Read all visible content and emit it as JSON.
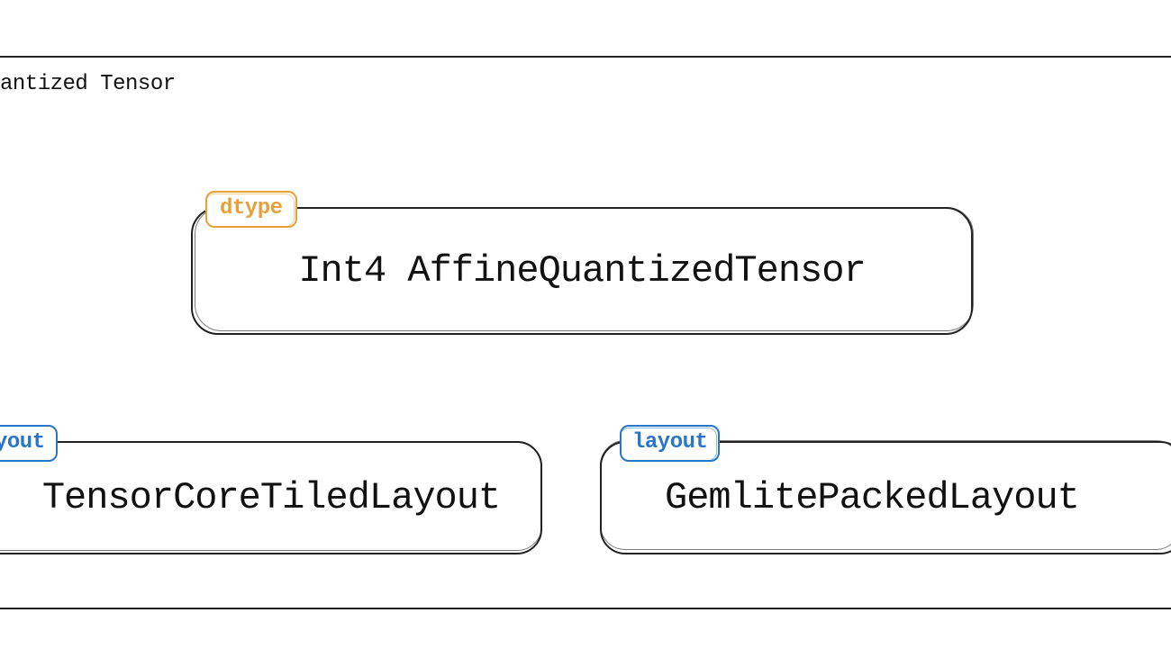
{
  "outer": {
    "title": "antized Tensor"
  },
  "main": {
    "tag_label": "dtype",
    "name": "Int4 AffineQuantizedTensor"
  },
  "layouts": {
    "left": {
      "tag_label": "yout",
      "name": "TensorCoreTiledLayout"
    },
    "right": {
      "tag_label": "layout",
      "name": "GemlitePackedLayout"
    }
  }
}
